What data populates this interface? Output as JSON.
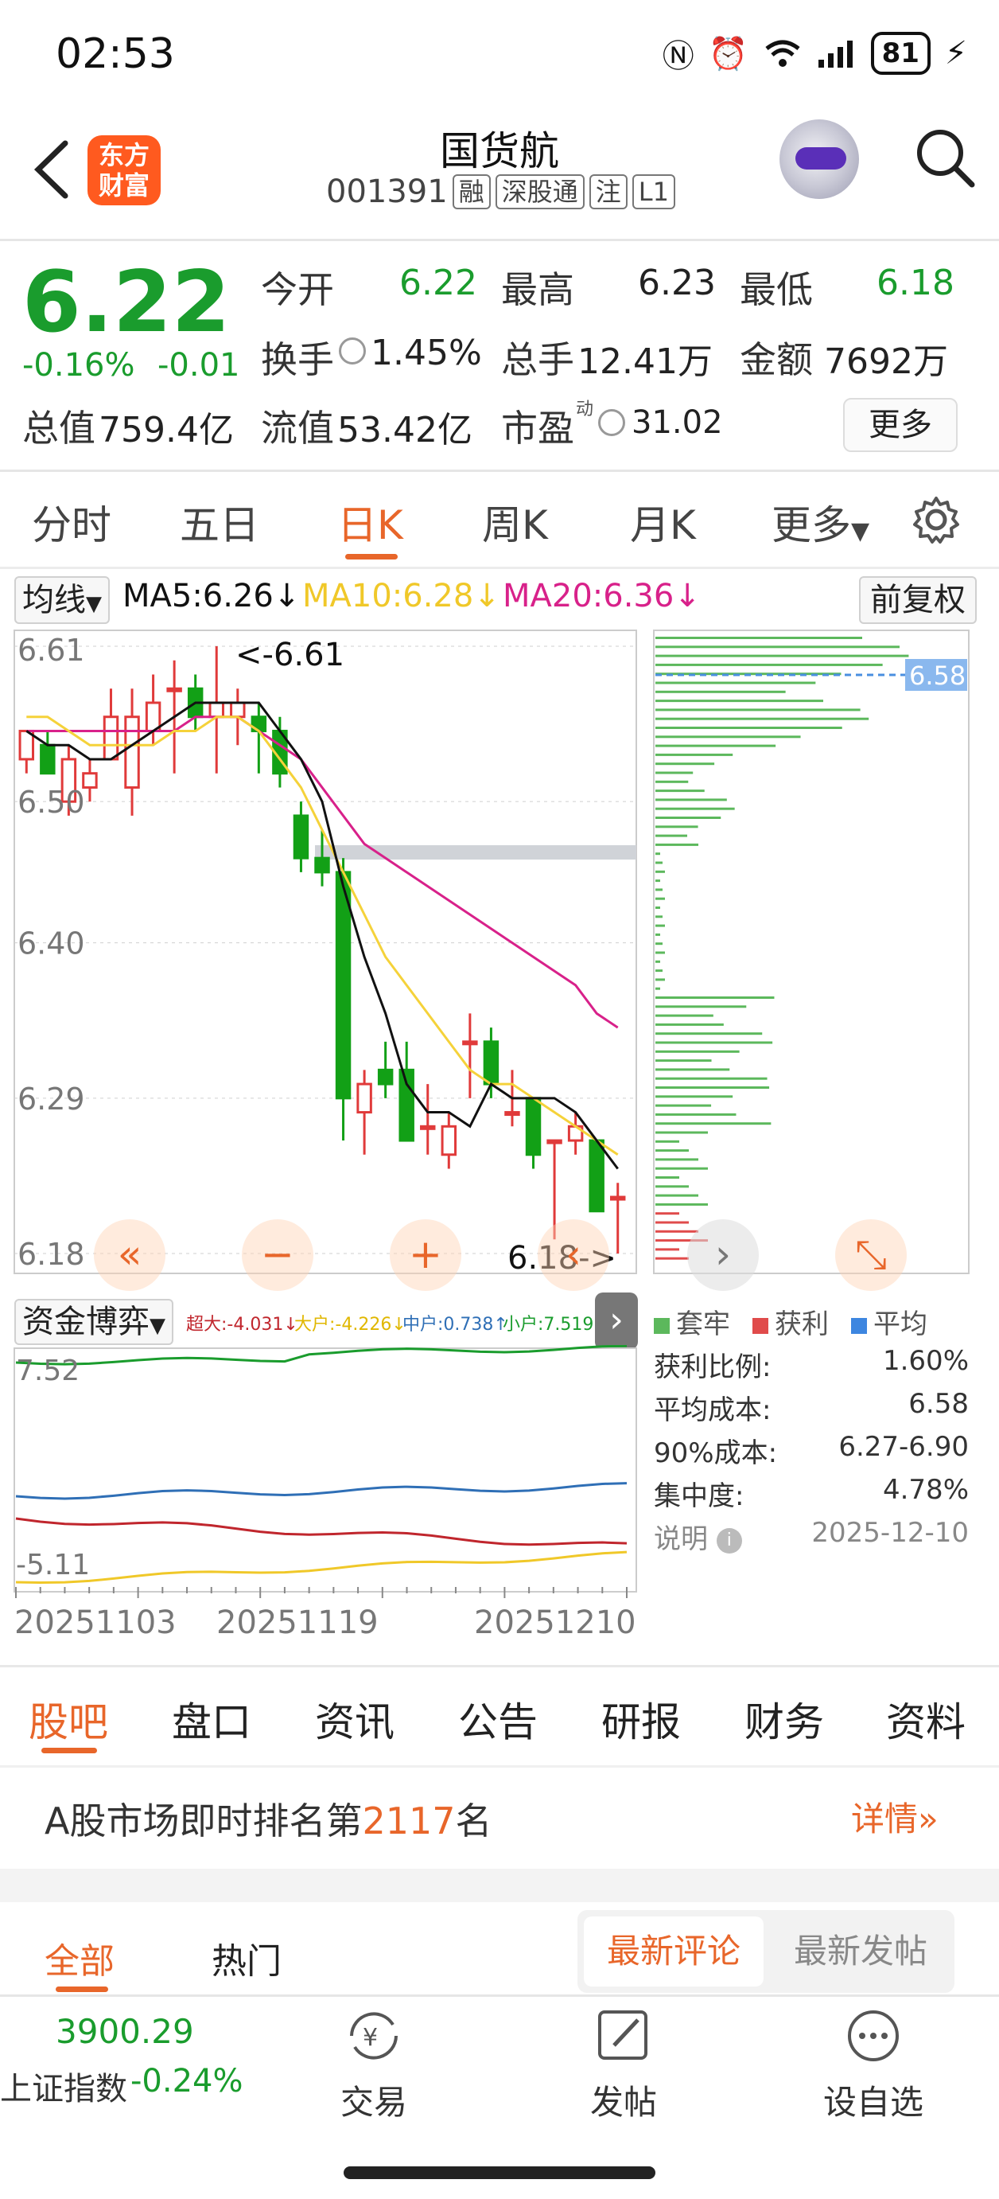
{
  "status_bar": {
    "time": "02:53",
    "battery": "81"
  },
  "header": {
    "name": "国货航",
    "code": "001391",
    "tags": [
      "融",
      "深股通",
      "注",
      "L1"
    ],
    "logo_text_1": "东方",
    "logo_text_2": "财富"
  },
  "quote": {
    "price": "6.22",
    "change_pct": "-0.16%",
    "change_abs": "-0.01",
    "open_label": "今开",
    "open": "6.22",
    "high_label": "最高",
    "high": "6.23",
    "low_label": "最低",
    "low": "6.18",
    "turnover_label": "换手",
    "turnover": "1.45%",
    "volume_label": "总手",
    "volume": "12.41万",
    "amount_label": "金额",
    "amount": "7692万",
    "mktcap_label": "总值",
    "mktcap": "759.4亿",
    "float_label": "流值",
    "float_cap": "53.42亿",
    "pe_label": "市盈",
    "pe_sup": "动",
    "pe": "31.02",
    "more": "更多"
  },
  "chart_tabs": [
    "分时",
    "五日",
    "日K",
    "周K",
    "月K",
    "更多"
  ],
  "ma_legend": {
    "select": "均线",
    "ma5": "MA5:6.26↓",
    "ma10": "MA10:6.28↓",
    "ma20": "MA20:6.36↓",
    "adjust": "前复权",
    "ma5_color": "#111111",
    "ma10_color": "#f5d23a",
    "ma20_color": "#d8218a"
  },
  "kline": {
    "y_labels": [
      "6.61",
      "6.50",
      "6.40",
      "6.29",
      "6.18"
    ],
    "high_marker": "<-6.61",
    "low_marker": "6.18->",
    "chip_avg": "6.58"
  },
  "chart_data": {
    "type": "candlestick",
    "ylim": [
      6.18,
      6.61
    ],
    "candles": [
      {
        "o": 6.53,
        "h": 6.55,
        "l": 6.52,
        "c": 6.55
      },
      {
        "o": 6.54,
        "h": 6.55,
        "l": 6.52,
        "c": 6.52
      },
      {
        "o": 6.5,
        "h": 6.54,
        "l": 6.49,
        "c": 6.53
      },
      {
        "o": 6.51,
        "h": 6.53,
        "l": 6.5,
        "c": 6.52
      },
      {
        "o": 6.53,
        "h": 6.58,
        "l": 6.53,
        "c": 6.56
      },
      {
        "o": 6.51,
        "h": 6.58,
        "l": 6.49,
        "c": 6.56
      },
      {
        "o": 6.55,
        "h": 6.59,
        "l": 6.54,
        "c": 6.57
      },
      {
        "o": 6.58,
        "h": 6.6,
        "l": 6.52,
        "c": 6.58
      },
      {
        "o": 6.58,
        "h": 6.59,
        "l": 6.55,
        "c": 6.56
      },
      {
        "o": 6.56,
        "h": 6.61,
        "l": 6.52,
        "c": 6.57
      },
      {
        "o": 6.56,
        "h": 6.58,
        "l": 6.54,
        "c": 6.57
      },
      {
        "o": 6.56,
        "h": 6.57,
        "l": 6.52,
        "c": 6.55
      },
      {
        "o": 6.55,
        "h": 6.56,
        "l": 6.51,
        "c": 6.52
      },
      {
        "o": 6.49,
        "h": 6.5,
        "l": 6.45,
        "c": 6.46
      },
      {
        "o": 6.46,
        "h": 6.48,
        "l": 6.44,
        "c": 6.45
      },
      {
        "o": 6.45,
        "h": 6.46,
        "l": 6.26,
        "c": 6.29
      },
      {
        "o": 6.28,
        "h": 6.31,
        "l": 6.25,
        "c": 6.3
      },
      {
        "o": 6.31,
        "h": 6.33,
        "l": 6.29,
        "c": 6.3
      },
      {
        "o": 6.31,
        "h": 6.33,
        "l": 6.26,
        "c": 6.26
      },
      {
        "o": 6.27,
        "h": 6.3,
        "l": 6.25,
        "c": 6.27
      },
      {
        "o": 6.25,
        "h": 6.28,
        "l": 6.24,
        "c": 6.27
      },
      {
        "o": 6.33,
        "h": 6.35,
        "l": 6.29,
        "c": 6.33
      },
      {
        "o": 6.33,
        "h": 6.34,
        "l": 6.29,
        "c": 6.3
      },
      {
        "o": 6.28,
        "h": 6.31,
        "l": 6.27,
        "c": 6.28
      },
      {
        "o": 6.29,
        "h": 6.29,
        "l": 6.24,
        "c": 6.25
      },
      {
        "o": 6.26,
        "h": 6.26,
        "l": 6.19,
        "c": 6.26
      },
      {
        "o": 6.26,
        "h": 6.28,
        "l": 6.25,
        "c": 6.27
      },
      {
        "o": 6.26,
        "h": 6.26,
        "l": 6.21,
        "c": 6.21
      },
      {
        "o": 6.22,
        "h": 6.23,
        "l": 6.18,
        "c": 6.22
      }
    ],
    "ma5": [
      6.55,
      6.54,
      6.54,
      6.53,
      6.53,
      6.54,
      6.55,
      6.56,
      6.57,
      6.57,
      6.57,
      6.57,
      6.55,
      6.53,
      6.5,
      6.44,
      6.39,
      6.35,
      6.3,
      6.28,
      6.28,
      6.27,
      6.3,
      6.29,
      6.29,
      6.29,
      6.28,
      6.26,
      6.24
    ],
    "ma10": [
      6.56,
      6.56,
      6.55,
      6.54,
      6.54,
      6.54,
      6.54,
      6.55,
      6.55,
      6.56,
      6.56,
      6.55,
      6.53,
      6.51,
      6.48,
      6.45,
      6.42,
      6.39,
      6.37,
      6.35,
      6.33,
      6.31,
      6.3,
      6.3,
      6.29,
      6.28,
      6.27,
      6.26,
      6.25
    ],
    "ma20": [
      6.55,
      6.55,
      6.55,
      6.55,
      6.55,
      6.55,
      6.55,
      6.55,
      6.56,
      6.56,
      6.56,
      6.55,
      6.54,
      6.53,
      6.51,
      6.49,
      6.47,
      6.46,
      6.45,
      6.44,
      6.43,
      6.42,
      6.41,
      6.4,
      6.39,
      6.38,
      6.37,
      6.35,
      6.34
    ]
  },
  "capital_flow": {
    "select": "资金博弈",
    "super_large": "超大:-4.031↓",
    "large": "大户:-4.226↓",
    "medium": "中户:0.738↑",
    "small": "小户:7.519↑",
    "y_max": "7.52",
    "y_min": "-5.11",
    "dates": [
      "20251103",
      "20251119",
      "20251210"
    ]
  },
  "chip_info": {
    "legend": [
      "套牢",
      "获利",
      "平均"
    ],
    "rows": [
      {
        "label": "获利比例:",
        "value": "1.60%"
      },
      {
        "label": "平均成本:",
        "value": "6.58"
      },
      {
        "label": "90%成本:",
        "value": "6.27-6.90"
      },
      {
        "label": "集中度:",
        "value": "4.78%"
      },
      {
        "label": "说明",
        "value": "2025-12-10"
      }
    ]
  },
  "news_tabs": [
    "股吧",
    "盘口",
    "资讯",
    "公告",
    "研报",
    "财务",
    "资料"
  ],
  "rank": {
    "prefix": "A股市场即时排名第",
    "number": "2117",
    "suffix": "名",
    "detail": "详情"
  },
  "post_tabs": {
    "all": "全部",
    "hot": "热门",
    "latest_comment": "最新评论",
    "latest_post": "最新发帖"
  },
  "toolbar": {
    "index_value": "3900.29",
    "index_name": "上证指数",
    "index_change": "-0.24%",
    "trade": "交易",
    "post": "发帖",
    "watchlist": "设自选"
  }
}
